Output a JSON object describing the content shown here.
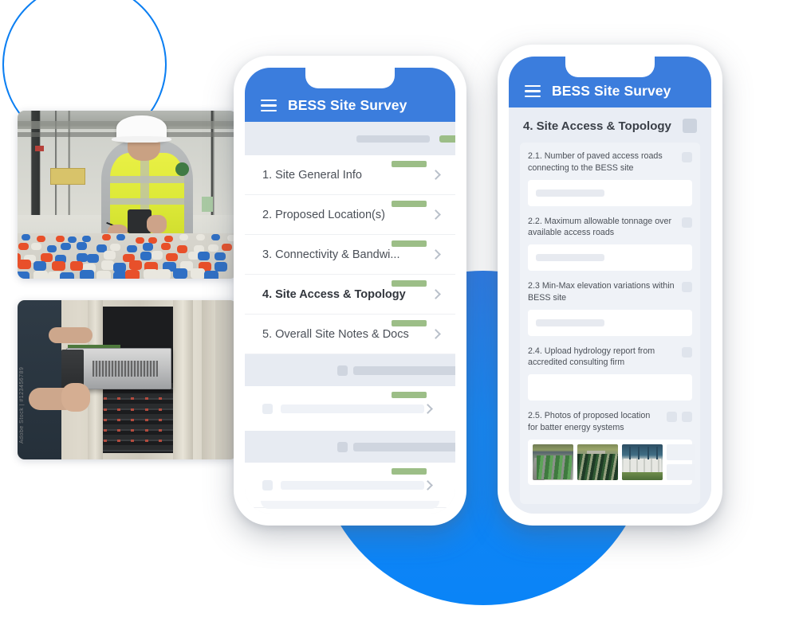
{
  "decor": {
    "ring_color": "#0c7ff2",
    "big_circle_color": "#0a84f7",
    "accent_blue": "#3b7ddd",
    "accent_green": "#9cbe87"
  },
  "photos": [
    {
      "name": "technician-battery-test",
      "alt": "Technician in yellow hi-vis vest and white hard hat testing a battery bank with red and blue terminal caps"
    },
    {
      "name": "technician-rack-install",
      "alt": "Technician sliding a rack-mount server unit into an equipment cabinet",
      "watermark": "Adobe Stock | #123456789"
    }
  ],
  "phone1": {
    "appbar": {
      "menu_icon": "hamburger-icon",
      "title": "BESS Site Survey"
    },
    "sections": [
      {
        "label": "1. Site General Info",
        "selected": false
      },
      {
        "label": "2. Proposed Location(s)",
        "selected": false
      },
      {
        "label": "3. Connectivity & Bandwi...",
        "selected": false
      },
      {
        "label": "4. Site Access & Topology",
        "selected": true
      },
      {
        "label": "5. Overall Site Notes & Docs",
        "selected": false
      }
    ],
    "chevron_icon": "chevron-right-icon"
  },
  "phone2": {
    "appbar": {
      "menu_icon": "hamburger-icon",
      "title": "BESS Site Survey"
    },
    "section_title": "4. Site Access & Topology",
    "questions": [
      {
        "text": "2.1. Number of paved access roads connecting to the BESS site",
        "badges": 1,
        "field": "value-placeholder",
        "type": "text"
      },
      {
        "text": "2.2. Maximum allowable tonnage over available access roads",
        "badges": 1,
        "field": "value-placeholder",
        "type": "text"
      },
      {
        "text": "2.3 Min-Max elevation variations within BESS site",
        "badges": 1,
        "field": "value-placeholder",
        "type": "text"
      },
      {
        "text": "2.4. Upload hydrology report from accredited consulting firm",
        "badges": 1,
        "field": "",
        "type": "upload"
      },
      {
        "text": "2.5. Photos of proposed location for batter energy systems",
        "badges": 2,
        "field": "",
        "type": "photos",
        "photos": [
          {
            "name": "bess-green-containers-row",
            "alt": "Row of green battery energy storage containers"
          },
          {
            "name": "bess-dark-container-array",
            "alt": "Array of dark green BESS containers in a field"
          },
          {
            "name": "bess-white-enclosure",
            "alt": "White battery storage enclosures beside grassland"
          }
        ],
        "empty_slots": 2
      }
    ]
  }
}
